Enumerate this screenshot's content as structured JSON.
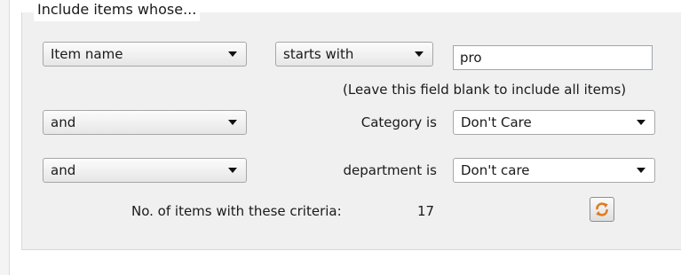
{
  "group": {
    "legend": "Include items whose..."
  },
  "row1": {
    "field": "Item name",
    "operator": "starts with",
    "value": "pro"
  },
  "hint": "(Leave this field blank to include all items)",
  "row2": {
    "conjunction": "and",
    "label": "Category is",
    "value": "Don't Care"
  },
  "row3": {
    "conjunction": "and",
    "label": "department is",
    "value": "Don't care"
  },
  "count": {
    "label": "No. of items with these criteria:",
    "value": "17"
  },
  "icons": {
    "refresh": "refresh-icon"
  },
  "colors": {
    "refresh_accent": "#e07a1f"
  }
}
